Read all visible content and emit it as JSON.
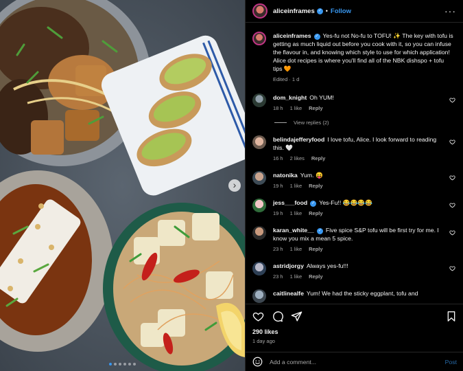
{
  "post": {
    "username": "aliceinframes",
    "follow_label": "Follow",
    "separator": "•",
    "more_icon": "more-horizontal-icon"
  },
  "caption": {
    "username": "aliceinframes",
    "text": "Yes-fu not No-fu to TOFU! ✨ The key with tofu is getting as much liquid out before you cook with it, so you can infuse the flavour in, and knowing which style to use for which application! Alice dot recipes is where you'll find all of the NBK dishspo + tofu tips 🧡",
    "meta": "Edited · 1 d"
  },
  "comments": [
    {
      "username": "dom_knight",
      "text": "Oh YUM!",
      "time": "18 h",
      "likes": "1 like",
      "reply": "Reply",
      "view_replies": "View replies (2)"
    },
    {
      "username": "belindajefferyfood",
      "text": "I love tofu, Alice. I look forward to reading this. 🤍",
      "time": "16 h",
      "likes": "2 likes",
      "reply": "Reply"
    },
    {
      "username": "natonika",
      "text": "Yum. 😝",
      "time": "19 h",
      "likes": "1 like",
      "reply": "Reply"
    },
    {
      "username": "jess___food",
      "text": "Yes-Fu!! 😂😂😂😂",
      "time": "19 h",
      "likes": "1 like",
      "reply": "Reply"
    },
    {
      "username": "karan_white__",
      "text": "Five spice S&P tofu will be first try for me. I know you mix a mean 5 spice.",
      "time": "23 h",
      "likes": "1 like",
      "reply": "Reply"
    },
    {
      "username": "astridjorgy",
      "text": "Always yes-fu!!!",
      "time": "23 h",
      "likes": "1 like",
      "reply": "Reply"
    },
    {
      "username": "caitlinealfe",
      "text": "Yum! We had the sticky eggplant, tofu and",
      "time": "",
      "likes": "",
      "reply": ""
    }
  ],
  "actions": {
    "likes": "290 likes",
    "ago": "1 day ago"
  },
  "add_comment": {
    "placeholder": "Add a comment...",
    "post_label": "Post"
  },
  "carousel": {
    "count": 6,
    "active_index": 0
  },
  "colors": {
    "accent": "#3897f0",
    "background": "#000000",
    "muted": "#a8a8a8"
  }
}
